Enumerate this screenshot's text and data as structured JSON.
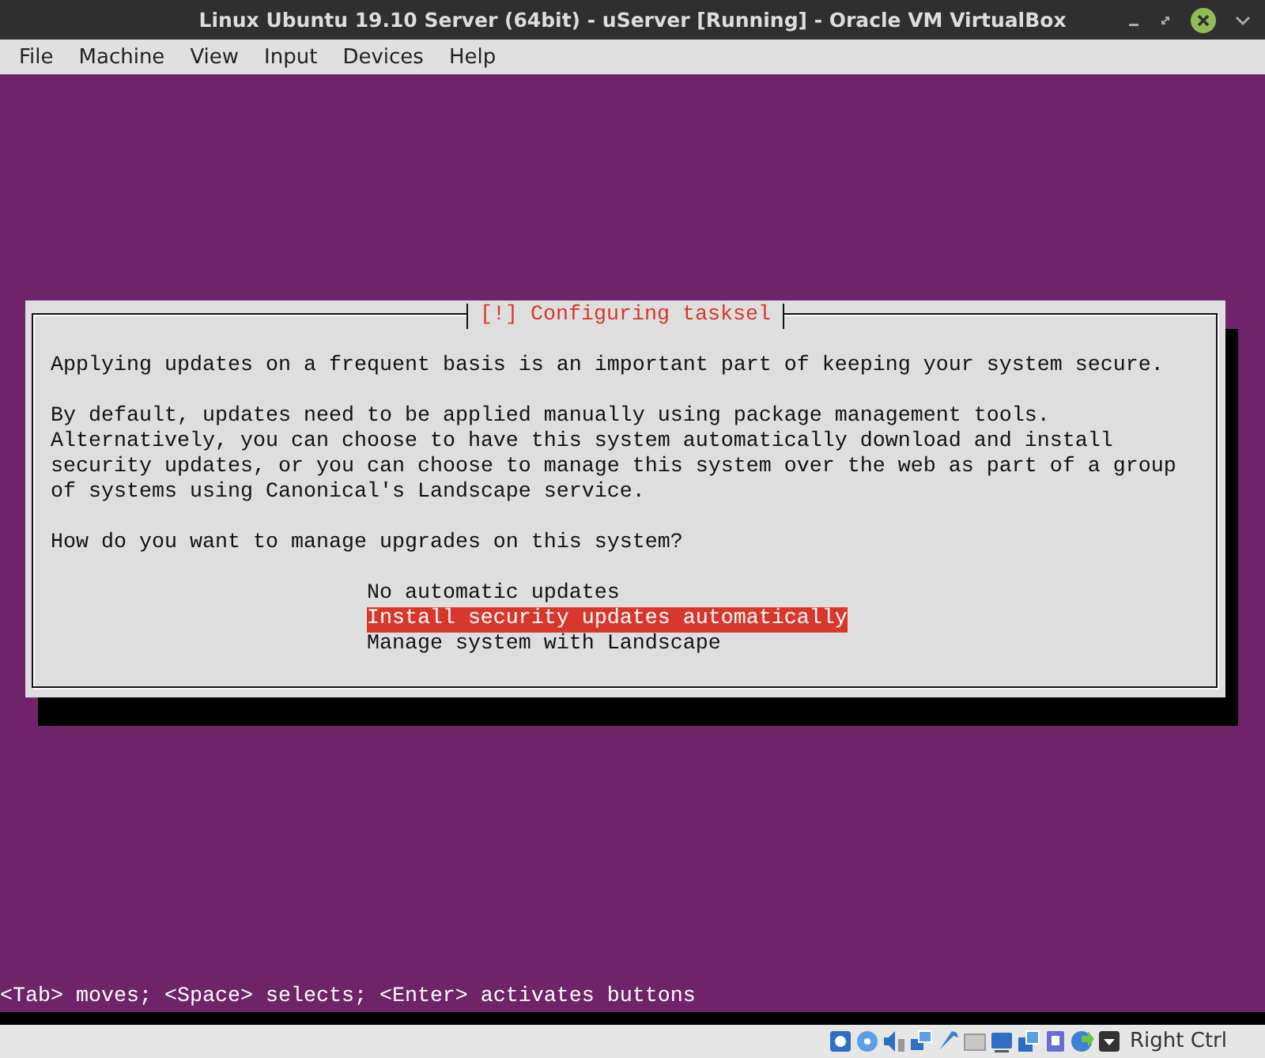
{
  "window": {
    "title": "Linux Ubuntu 19.10 Server (64bit) - uServer [Running] - Oracle VM VirtualBox"
  },
  "menu": [
    "File",
    "Machine",
    "View",
    "Input",
    "Devices",
    "Help"
  ],
  "dialog": {
    "title": "[!] Configuring tasksel",
    "paragraphs": [
      "Applying updates on a frequent basis is an important part of keeping your system secure.",
      "By default, updates need to be applied manually using package management tools. Alternatively, you can choose to have this system automatically download and install security updates, or you can choose to manage this system over the web as part of a group of systems using Canonical's Landscape service.",
      "How do you want to manage upgrades on this system?"
    ],
    "options": [
      {
        "label": "No automatic updates",
        "selected": false
      },
      {
        "label": "Install security updates automatically",
        "selected": true
      },
      {
        "label": "Manage system with Landscape",
        "selected": false
      }
    ]
  },
  "console_hint": "<Tab> moves; <Space> selects; <Enter> activates buttons",
  "status_bar": {
    "host_key": "Right Ctrl"
  }
}
